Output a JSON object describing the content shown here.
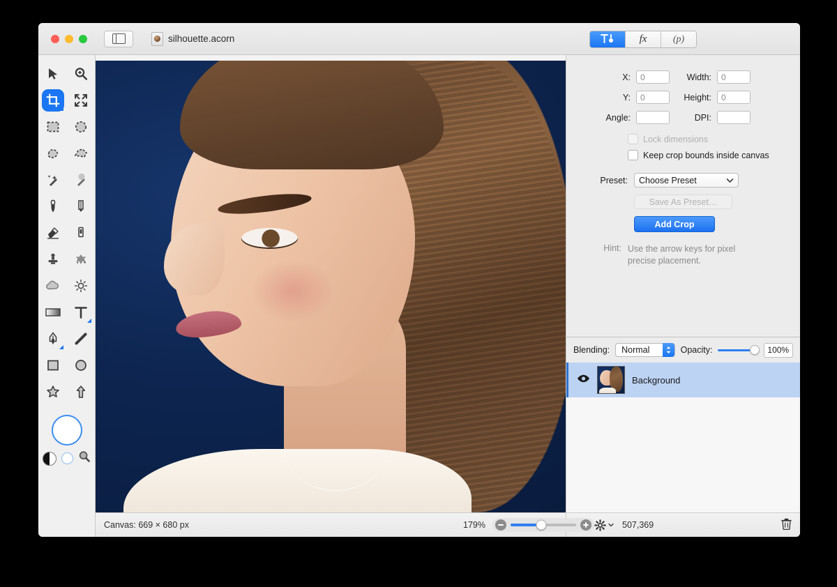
{
  "window": {
    "document_name": "silhouette.acorn",
    "traffic_lights": [
      "close",
      "minimize",
      "zoom"
    ],
    "sidebar_toggle_icon": "sidebar-icon"
  },
  "inspector_tabs": [
    {
      "id": "tools",
      "label": "Tools",
      "icon": "hammer-pen-icon",
      "selected": true
    },
    {
      "id": "filters",
      "label": "fx",
      "icon": "fx-icon",
      "selected": false
    },
    {
      "id": "palettes",
      "label": "(p)",
      "icon": "palette-icon",
      "selected": false
    }
  ],
  "tools": [
    {
      "name": "move-tool",
      "icon": "arrow-cursor-icon",
      "selected": false
    },
    {
      "name": "zoom-tool",
      "icon": "magnifier-plus-icon",
      "selected": false
    },
    {
      "name": "crop-tool",
      "icon": "crop-icon",
      "selected": true
    },
    {
      "name": "transform-tool",
      "icon": "arrows-expand-icon",
      "selected": false
    },
    {
      "name": "rectangular-select-tool",
      "icon": "marquee-rect-icon",
      "selected": false
    },
    {
      "name": "elliptical-select-tool",
      "icon": "marquee-ellipse-icon",
      "selected": false
    },
    {
      "name": "lasso-tool",
      "icon": "lasso-icon",
      "selected": false
    },
    {
      "name": "polygon-select-tool",
      "icon": "polygon-lasso-icon",
      "selected": false
    },
    {
      "name": "magic-wand-tool",
      "icon": "magic-wand-icon",
      "selected": false
    },
    {
      "name": "instant-alpha-tool",
      "icon": "instant-alpha-icon",
      "selected": false
    },
    {
      "name": "paintbrush-tool",
      "icon": "paintbrush-icon",
      "selected": false
    },
    {
      "name": "pencil-tool",
      "icon": "pencil-icon",
      "selected": false
    },
    {
      "name": "eraser-tool",
      "icon": "eraser-icon",
      "selected": false
    },
    {
      "name": "marker-tool",
      "icon": "marker-icon",
      "selected": false
    },
    {
      "name": "clone-stamp-tool",
      "icon": "clone-stamp-icon",
      "selected": false
    },
    {
      "name": "smudge-tool",
      "icon": "splatter-icon",
      "selected": false
    },
    {
      "name": "blur-tool",
      "icon": "cloud-icon",
      "selected": false
    },
    {
      "name": "dodge-tool",
      "icon": "sun-icon",
      "selected": false
    },
    {
      "name": "gradient-tool",
      "icon": "gradient-icon",
      "selected": false
    },
    {
      "name": "text-tool",
      "icon": "text-t-icon",
      "selected": false
    },
    {
      "name": "bezier-pen-tool",
      "icon": "pen-nib-icon",
      "selected": false
    },
    {
      "name": "line-tool",
      "icon": "line-icon",
      "selected": false
    },
    {
      "name": "rectangle-shape-tool",
      "icon": "rectangle-icon",
      "selected": false
    },
    {
      "name": "ellipse-shape-tool",
      "icon": "ellipse-icon",
      "selected": false
    },
    {
      "name": "star-shape-tool",
      "icon": "star-icon",
      "selected": false
    },
    {
      "name": "arrow-shape-tool",
      "icon": "arrow-up-icon",
      "selected": false
    }
  ],
  "color_well": {
    "foreground": "#ffffff",
    "ring": "#3b8ef0",
    "swap_icon": "swap-colors-icon",
    "background_icon": "background-color-icon",
    "picker_icon": "color-picker-magnifier-icon"
  },
  "crop_panel": {
    "fields": [
      {
        "label": "X:",
        "value": "0",
        "name": "crop-x-field"
      },
      {
        "label": "Width:",
        "value": "0",
        "name": "crop-width-field"
      },
      {
        "label": "Y:",
        "value": "0",
        "name": "crop-y-field"
      },
      {
        "label": "Height:",
        "value": "0",
        "name": "crop-height-field"
      },
      {
        "label": "Angle:",
        "value": "",
        "name": "crop-angle-field"
      },
      {
        "label": "DPI:",
        "value": "",
        "name": "crop-dpi-field"
      }
    ],
    "checkboxes": [
      {
        "label": "Lock dimensions",
        "checked": false,
        "disabled": true,
        "name": "lock-dimensions-checkbox"
      },
      {
        "label": "Keep crop bounds inside canvas",
        "checked": false,
        "disabled": false,
        "name": "keep-crop-bounds-checkbox"
      }
    ],
    "preset_label": "Preset:",
    "preset_value": "Choose Preset",
    "save_preset_label": "Save As Preset…",
    "add_crop_label": "Add Crop",
    "hint_label": "Hint:",
    "hint_text": "Use the arrow keys for pixel precise placement."
  },
  "layers_panel": {
    "blending_label": "Blending:",
    "blending_value": "Normal",
    "opacity_label": "Opacity:",
    "opacity_value": "100%",
    "opacity_percent": 100,
    "layers": [
      {
        "name": "Background",
        "visible": true,
        "selected": true,
        "visibility_icon": "eye-icon"
      }
    ]
  },
  "status_bar": {
    "canvas_label": "Canvas: 669 × 680 px",
    "zoom_level": "179%",
    "zoom_slider_percent": 47,
    "zoom_out_icon": "minus-circle-icon",
    "zoom_in_icon": "plus-circle-icon",
    "add_layer_icon": "plus-icon",
    "layer_actions_icon": "gear-dropdown-icon",
    "file_size": "507,369",
    "delete_icon": "trash-icon"
  },
  "colors": {
    "accent_blue": "#1a76f2",
    "selection_blue": "#bdd3f3",
    "canvas_background": "#0d2550",
    "window_chrome": "#ececec"
  }
}
